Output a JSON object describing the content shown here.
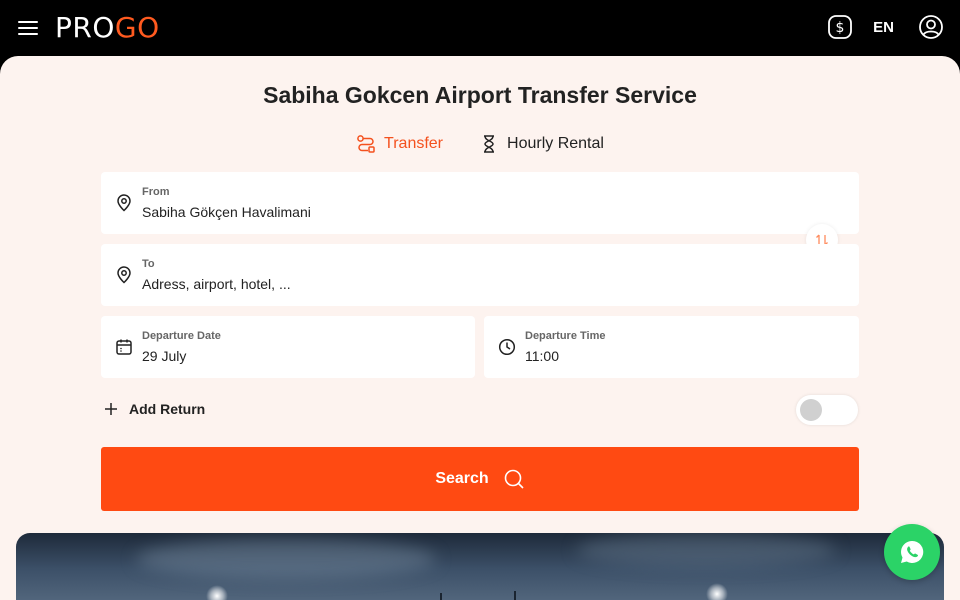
{
  "header": {
    "logo_pro": "PRO",
    "logo_go": "GO",
    "language": "EN",
    "icons": {
      "menu": "hamburger-menu-icon",
      "currency": "dollar-icon",
      "user": "user-circle-icon"
    }
  },
  "booking": {
    "title": "Sabiha Gokcen Airport Transfer Service",
    "tabs": [
      {
        "label": "Transfer",
        "icon": "route-icon",
        "active": true
      },
      {
        "label": "Hourly Rental",
        "icon": "hourglass-icon",
        "active": false
      }
    ],
    "from": {
      "label": "From",
      "value": "Sabiha Gökçen Havalimani"
    },
    "to": {
      "label": "To",
      "placeholder": "Adress, airport, hotel, ..."
    },
    "departure_date": {
      "label": "Departure Date",
      "value": "29 July"
    },
    "departure_time": {
      "label": "Departure Time",
      "value": "11:00"
    },
    "add_return_label": "Add Return",
    "search_label": "Search"
  },
  "colors": {
    "accent": "#ff4a12",
    "panel_bg": "#fdf3ef",
    "whatsapp": "#2bd367"
  }
}
